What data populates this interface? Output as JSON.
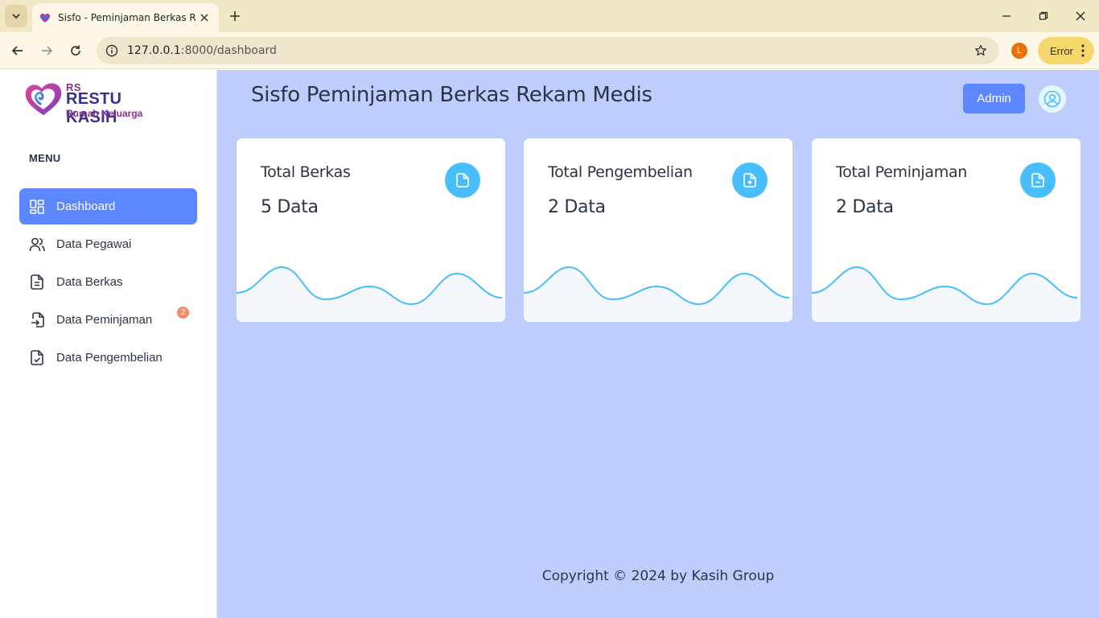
{
  "browser": {
    "tab_title": "Sisfo - Peminjaman Berkas Reka",
    "url_host": "127.0.0.1",
    "url_path": ":8000/dashboard",
    "profile_initial": "L",
    "error_label": "Error"
  },
  "sidebar": {
    "logo": {
      "rs": "RS",
      "brand": "RESTU KASIH",
      "tagline": "Rumah Keluarga"
    },
    "menu_heading": "MENU",
    "items": [
      {
        "label": "Dashboard",
        "icon": "dashboard-icon",
        "active": true
      },
      {
        "label": "Data Pegawai",
        "icon": "users-icon"
      },
      {
        "label": "Data Berkas",
        "icon": "file-text-icon"
      },
      {
        "label": "Data Peminjaman",
        "icon": "file-import-icon",
        "badge": "2"
      },
      {
        "label": "Data Pengembelian",
        "icon": "file-check-icon"
      }
    ]
  },
  "header": {
    "title": "Sisfo Peminjaman Berkas Rekam Medis",
    "admin_label": "Admin"
  },
  "cards": [
    {
      "label": "Total Berkas",
      "value": "5 Data",
      "icon": "file-icon"
    },
    {
      "label": "Total Pengembelian",
      "value": "2 Data",
      "icon": "file-plus-icon"
    },
    {
      "label": "Total Peminjaman",
      "value": "2 Data",
      "icon": "file-minus-icon"
    }
  ],
  "footer": {
    "text": "Copyright © 2024 by Kasih Group"
  },
  "colors": {
    "primary": "#5d87ff",
    "accent": "#49beff",
    "main_bg": "#bfcdfc",
    "badge": "#fa896b"
  }
}
